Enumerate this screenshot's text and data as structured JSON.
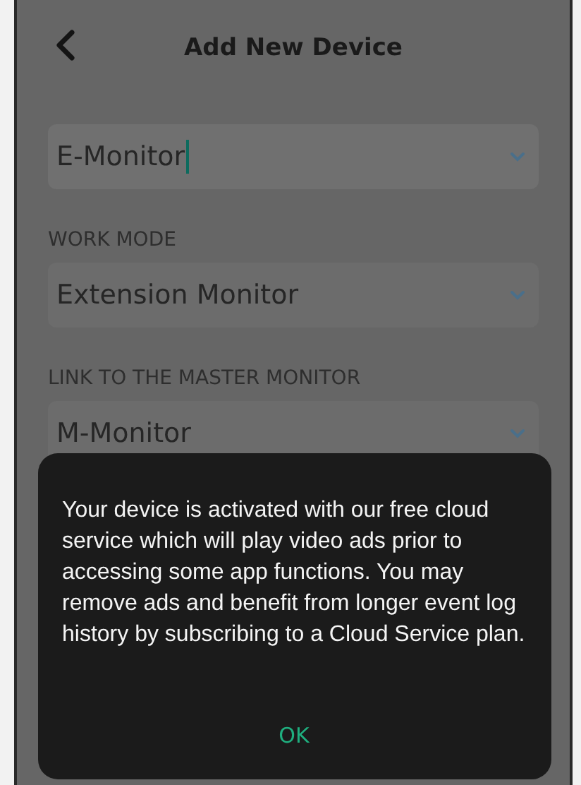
{
  "header": {
    "title": "Add New Device"
  },
  "fields": [
    {
      "value": "E-Monitor",
      "focused": true
    },
    {
      "label": "WORK MODE",
      "value": "Extension Monitor",
      "focused": false
    },
    {
      "label": "LINK TO THE MASTER MONITOR",
      "value": "M-Monitor",
      "focused": false
    }
  ],
  "dialog": {
    "message": "Your device is activated with our free cloud service which will play video ads prior to accessing some app functions. You may remove ads and benefit from longer event log history by subscribing to a Cloud Service plan.",
    "button": "OK"
  }
}
